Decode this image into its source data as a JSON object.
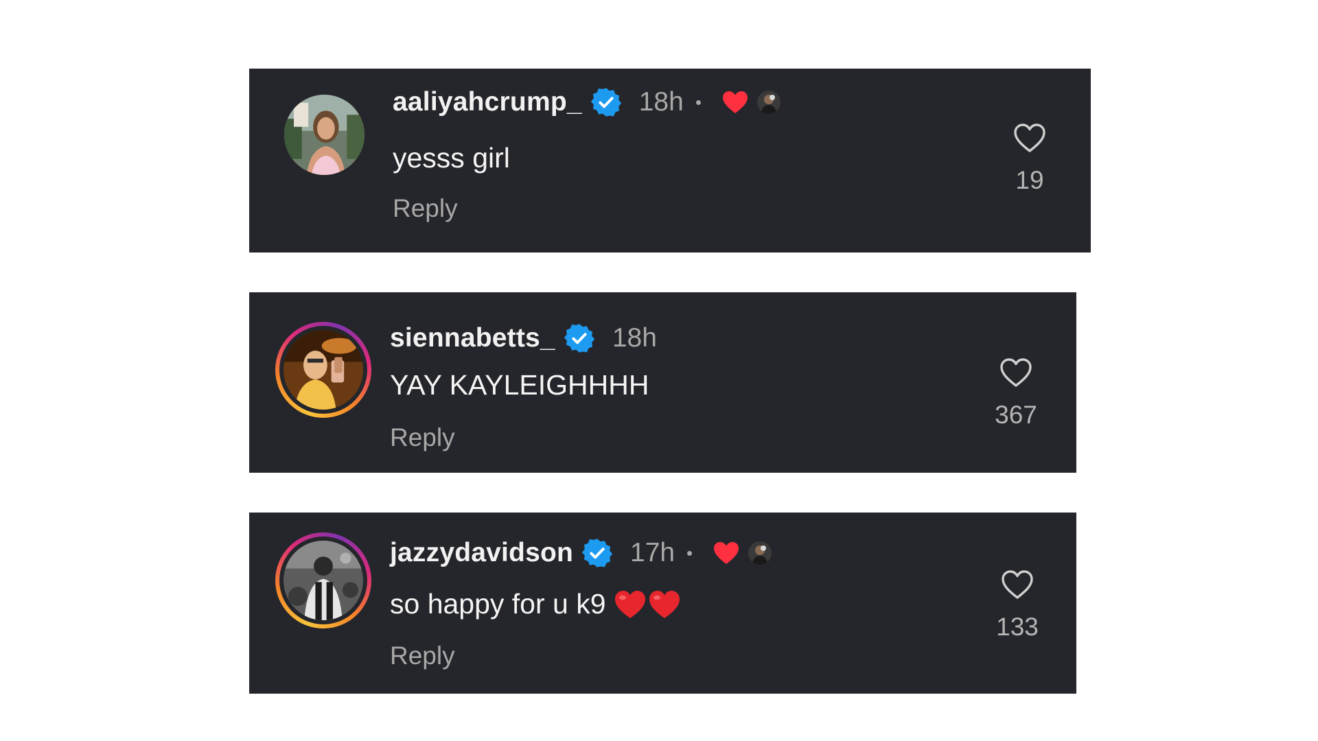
{
  "comments": [
    {
      "username": "aaliyahcrump_",
      "verified": true,
      "time": "18h",
      "liked_by_creator": true,
      "text": "yesss girl",
      "emoji_hearts": 0,
      "reply_label": "Reply",
      "like_count": "19",
      "avatar_ring": false
    },
    {
      "username": "siennabetts_",
      "verified": true,
      "time": "18h",
      "liked_by_creator": false,
      "text": "YAY KAYLEIGHHHH",
      "emoji_hearts": 0,
      "reply_label": "Reply",
      "like_count": "367",
      "avatar_ring": true
    },
    {
      "username": "jazzydavidson",
      "verified": true,
      "time": "17h",
      "liked_by_creator": true,
      "text": "so happy for u k9",
      "emoji_hearts": 2,
      "reply_label": "Reply",
      "like_count": "133",
      "avatar_ring": true
    }
  ],
  "colors": {
    "card_background": "#25262b",
    "verified_blue": "#1d9bf0",
    "heart_red": "#ff3040",
    "secondary_text": "#a8a8a8"
  },
  "icons": {
    "verified": "verified-badge-icon",
    "creator_liked": "red-heart-icon",
    "like": "heart-outline-icon"
  }
}
